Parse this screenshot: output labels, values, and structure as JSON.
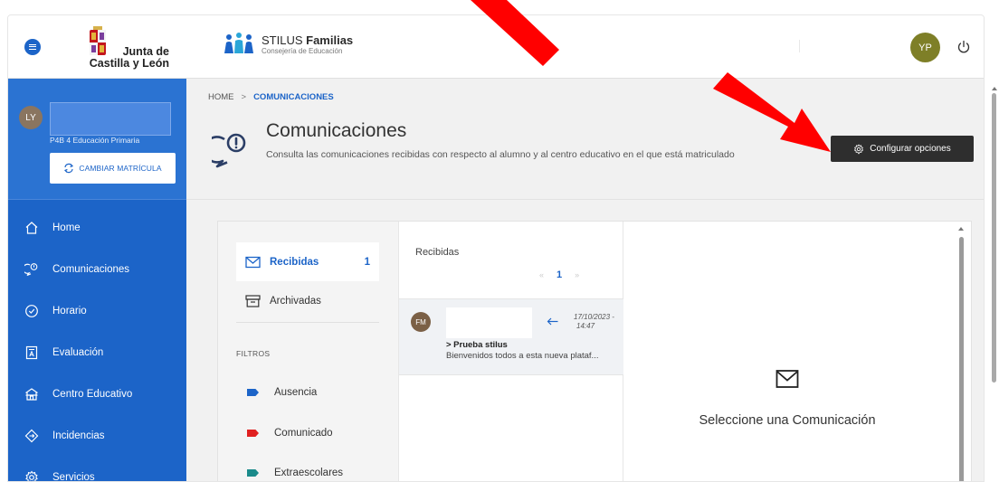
{
  "header": {
    "menu_icon": "hamburger-icon",
    "org_logo_line1": "Junta de",
    "org_logo_line2": "Castilla y León",
    "app_name_prefix": "STILUS ",
    "app_name_bold": "Familias",
    "app_subtitle": "Consejería de Educación",
    "user_initials": "YP",
    "user_avatar_color": "#7e7f27",
    "logout_icon": "power-icon"
  },
  "sidebar": {
    "student": {
      "initials": "LY",
      "course": "P4B 4 Educación Primaria",
      "change_button": "CAMBIAR MATRÍCULA"
    },
    "items": [
      {
        "label": "Home",
        "icon": "home-icon"
      },
      {
        "label": "Comunicaciones",
        "icon": "chat-icon"
      },
      {
        "label": "Horario",
        "icon": "clock-icon"
      },
      {
        "label": "Evaluación",
        "icon": "grade-icon"
      },
      {
        "label": "Centro Educativo",
        "icon": "school-icon"
      },
      {
        "label": "Incidencias",
        "icon": "diamond-icon"
      },
      {
        "label": "Servicios",
        "icon": "gear-icon"
      }
    ]
  },
  "breadcrumb": {
    "home": "HOME",
    "separator": ">",
    "current": "COMUNICACIONES"
  },
  "page": {
    "title": "Comunicaciones",
    "description": "Consulta las comunicaciones recibidas con respecto al alumno y al centro educativo en el que está matriculado",
    "config_button": "Configurar opciones"
  },
  "folders": {
    "items": [
      {
        "label": "Recibidas",
        "count": "1",
        "icon": "envelope-icon"
      },
      {
        "label": "Archivadas",
        "count": "",
        "icon": "archive-icon"
      }
    ],
    "filters_title": "FILTROS",
    "filters": [
      {
        "label": "Ausencia",
        "color": "#1c64c8"
      },
      {
        "label": "Comunicado",
        "color": "#e02020"
      },
      {
        "label": "Extraescolares",
        "color": "#1a8a8a"
      }
    ]
  },
  "list": {
    "title": "Recibidas",
    "pager": {
      "prev": "«",
      "page": "1",
      "next": "»"
    },
    "messages": [
      {
        "initials": "FM",
        "date_line1": "17/10/2023 -",
        "date_line2": "14:47",
        "subject": "> Prueba stilus",
        "preview": "Bienvenidos todos a esta nueva plataf..."
      }
    ]
  },
  "detail": {
    "empty_text": "Seleccione una Comunicación"
  },
  "colors": {
    "primary": "#1c64c8",
    "dark_button": "#2e2e2e",
    "annotation_arrow": "#ff0000"
  }
}
